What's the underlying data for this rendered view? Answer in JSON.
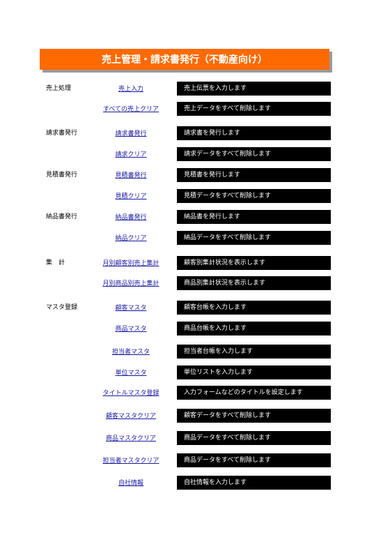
{
  "header": {
    "title": "売上管理・請求書発行（不動産向け）"
  },
  "rows": [
    {
      "section": "売上処理",
      "link": "売上入力",
      "desc": "売上伝票を入力します"
    },
    {
      "section": "",
      "link": "すべての売上クリア",
      "desc": "売上データをすべて削除します"
    },
    {
      "section": "請求書発行",
      "link": "請求書発行",
      "desc": "請求書を発行します"
    },
    {
      "section": "",
      "link": "請求クリア",
      "desc": "請求データをすべて削除します"
    },
    {
      "section": "見積書発行",
      "link": "見積書発行",
      "desc": "見積書を発行します"
    },
    {
      "section": "",
      "link": "見積クリア",
      "desc": "見積データをすべて削除します"
    },
    {
      "section": "納品書発行",
      "link": "納品書発行",
      "desc": "納品書を発行します"
    },
    {
      "section": "",
      "link": "納品クリア",
      "desc": "納品データをすべて削除します"
    },
    {
      "section": "集　計",
      "link": "月別顧客別売上集計",
      "desc": "顧客別集計状況を表示します"
    },
    {
      "section": "",
      "link": "月別商品別売上集計",
      "desc": "商品別集計状況を表示します"
    },
    {
      "section": "マスタ登録",
      "link": "顧客マスタ",
      "desc": "顧客台帳を入力します"
    },
    {
      "section": "",
      "link": "商品マスタ",
      "desc": "商品台帳を入力します"
    },
    {
      "section": "",
      "link": "担当者マスタ",
      "desc": "担当者台帳を入力します"
    },
    {
      "section": "",
      "link": "単位マスタ",
      "desc": "単位リストを入力します"
    },
    {
      "section": "",
      "link": "タイトルマスタ登録",
      "desc": "入力フォームなどのタイトルを設定します"
    },
    {
      "section": "",
      "link": "顧客マスタクリア",
      "desc": "顧客データをすべて削除します"
    },
    {
      "section": "",
      "link": "商品マスタクリア",
      "desc": "商品データをすべて削除します"
    },
    {
      "section": "",
      "link": "担当者マスタクリア",
      "desc": "商品データをすべて削除します"
    },
    {
      "section": "",
      "link": "自社情報",
      "desc": "自社情報を入力します"
    }
  ]
}
